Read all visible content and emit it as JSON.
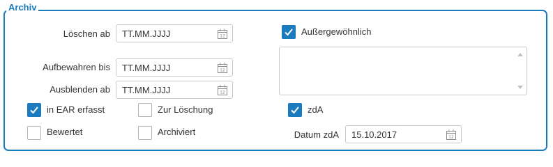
{
  "fieldset": {
    "legend": "Archiv"
  },
  "fields": {
    "loeschen_ab": {
      "label": "Löschen ab",
      "value": "TT.MM.JJJJ"
    },
    "aufbewahren_bis": {
      "label": "Aufbewahren bis",
      "value": "TT.MM.JJJJ"
    },
    "ausblenden_ab": {
      "label": "Ausblenden ab",
      "value": "TT.MM.JJJJ"
    },
    "datum_zda": {
      "label": "Datum zdA",
      "value": "15.10.2017"
    }
  },
  "checkboxes": {
    "ausserge": {
      "label": "Außergewöhnlich",
      "checked": true
    },
    "ear": {
      "label": "in EAR erfasst",
      "checked": true
    },
    "zur_loeschung": {
      "label": "Zur Löschung",
      "checked": false
    },
    "zda": {
      "label": "zdA",
      "checked": true
    },
    "bewertet": {
      "label": "Bewertet",
      "checked": false
    },
    "archiviert": {
      "label": "Archiviert",
      "checked": false
    }
  },
  "notes": {
    "value": ""
  },
  "colors": {
    "accent": "#1b7bbf",
    "border": "#c8c8c8",
    "text": "#333333"
  }
}
